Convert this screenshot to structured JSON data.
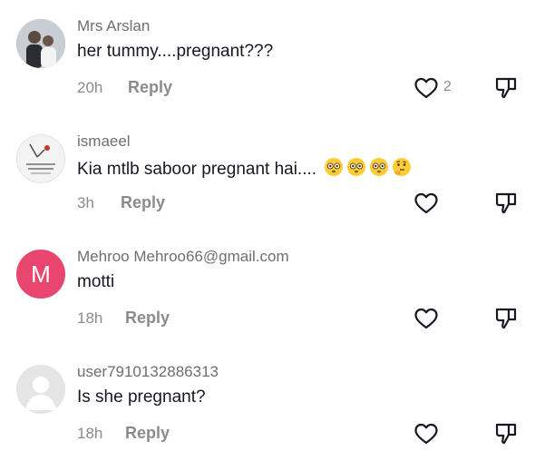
{
  "comments": [
    {
      "username": "Mrs Arslan",
      "text": "her tummy....pregnant???",
      "time": "20h",
      "reply": "Reply",
      "likes": "2",
      "avatar": "photo"
    },
    {
      "username": "ismaeel",
      "text": "Kia mtlb saboor pregnant hai....",
      "time": "3h",
      "reply": "Reply",
      "likes": "",
      "avatar": "drawing",
      "emojis": [
        "flushed-face",
        "flushed-face",
        "flushed-face",
        "thinking-face"
      ]
    },
    {
      "username": "Mehroo Mehroo66@gmail.com",
      "text": "motti",
      "time": "18h",
      "reply": "Reply",
      "likes": "",
      "avatar": "letter",
      "avatar_letter": "M",
      "avatar_color": "#e8466e"
    },
    {
      "username": "user7910132886313",
      "text": "Is she pregnant?",
      "time": "18h",
      "reply": "Reply",
      "likes": "",
      "avatar": "default"
    }
  ],
  "icons": {
    "like": "heart-outline-icon",
    "dislike": "thumbs-down-outline-icon"
  },
  "colors": {
    "username": "#6e6e73",
    "text": "#161823",
    "meta": "#8a8b91",
    "avatar_letter_bg": "#e8466e"
  }
}
